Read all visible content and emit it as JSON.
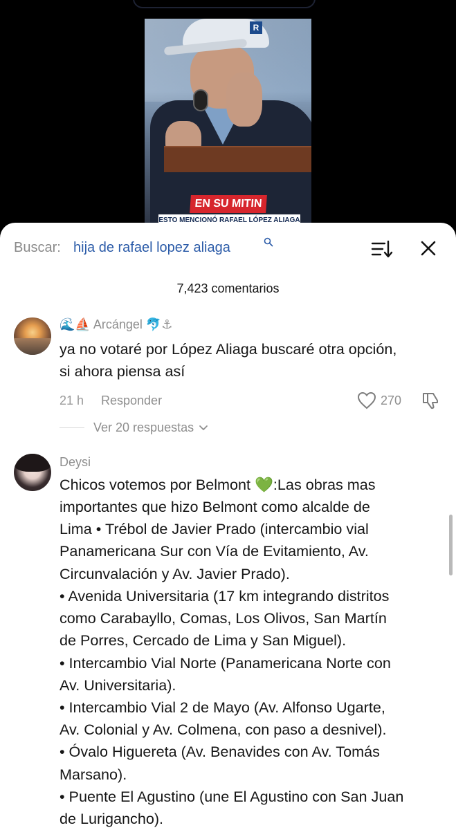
{
  "video": {
    "banner_text": "EN SU MITIN",
    "subtitle_text": "ESTO MENCIONÓ RAFAEL LÓPEZ ALIAGA",
    "cap_logo": "R"
  },
  "search": {
    "prefix": "Buscar:",
    "query": "hija de rafael lopez aliaga"
  },
  "comments_count": "7,423 comentarios",
  "comments": [
    {
      "username": "🌊⛵ Arcángel 🐬⚓",
      "lines": [
        "ya no votaré por López Aliaga buscaré otra opción,",
        "si ahora piensa así"
      ],
      "time": "21 h",
      "reply_label": "Responder",
      "likes": "270",
      "view_replies": "Ver 20 respuestas"
    },
    {
      "username": "Deysi",
      "lines": [
        "Chicos votemos por Belmont 💚:Las obras mas",
        "importantes que hizo Belmont como alcalde de",
        "Lima • Trébol de Javier Prado (intercambio vial",
        "Panamericana Sur con Vía de Evitamiento, Av.",
        "Circunvalación y Av. Javier Prado).",
        "• Avenida Universitaria (17 km integrando distritos",
        "como Carabayllo, Comas, Los Olivos, San Martín",
        "de Porres, Cercado de Lima y San Miguel).",
        "• Intercambio Vial Norte (Panamericana Norte con",
        "Av. Universitaria).",
        "• Intercambio Vial 2 de Mayo (Av. Alfonso Ugarte,",
        "Av. Colonial y Av. Colmena, con paso a desnivel).",
        "• Óvalo Higuereta (Av. Benavides con Av. Tomás",
        "Marsano).",
        "• Puente El Agustino (une El Agustino con San Juan",
        "de Lurigancho)."
      ]
    }
  ]
}
